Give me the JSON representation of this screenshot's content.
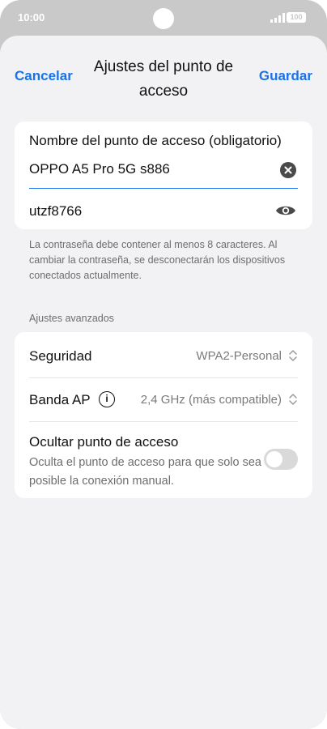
{
  "status_bar": {
    "time": "10:00",
    "battery": "100"
  },
  "header": {
    "cancel": "Cancelar",
    "title": "Ajustes del punto de acceso",
    "save": "Guardar"
  },
  "hotspot": {
    "name_label": "Nombre del punto de acceso (obligatorio)",
    "name_value": "OPPO A5 Pro 5G s886",
    "password_value": "utzf8766"
  },
  "help_text": "La contraseña debe contener al menos 8 caracteres. Al cambiar la contraseña, se desconectarán los dispositivos conectados actualmente.",
  "advanced": {
    "section_label": "Ajustes avanzados",
    "security_label": "Seguridad",
    "security_value": "WPA2-Personal",
    "band_label": "Banda AP",
    "band_value": "2,4 GHz (más compatible)",
    "hide_label": "Ocultar punto de acceso",
    "hide_description": "Oculta el punto de acceso para que solo sea posible la conexión manual.",
    "hide_enabled": false
  },
  "colors": {
    "accent": "#1a73e8",
    "background": "#f2f2f4"
  }
}
